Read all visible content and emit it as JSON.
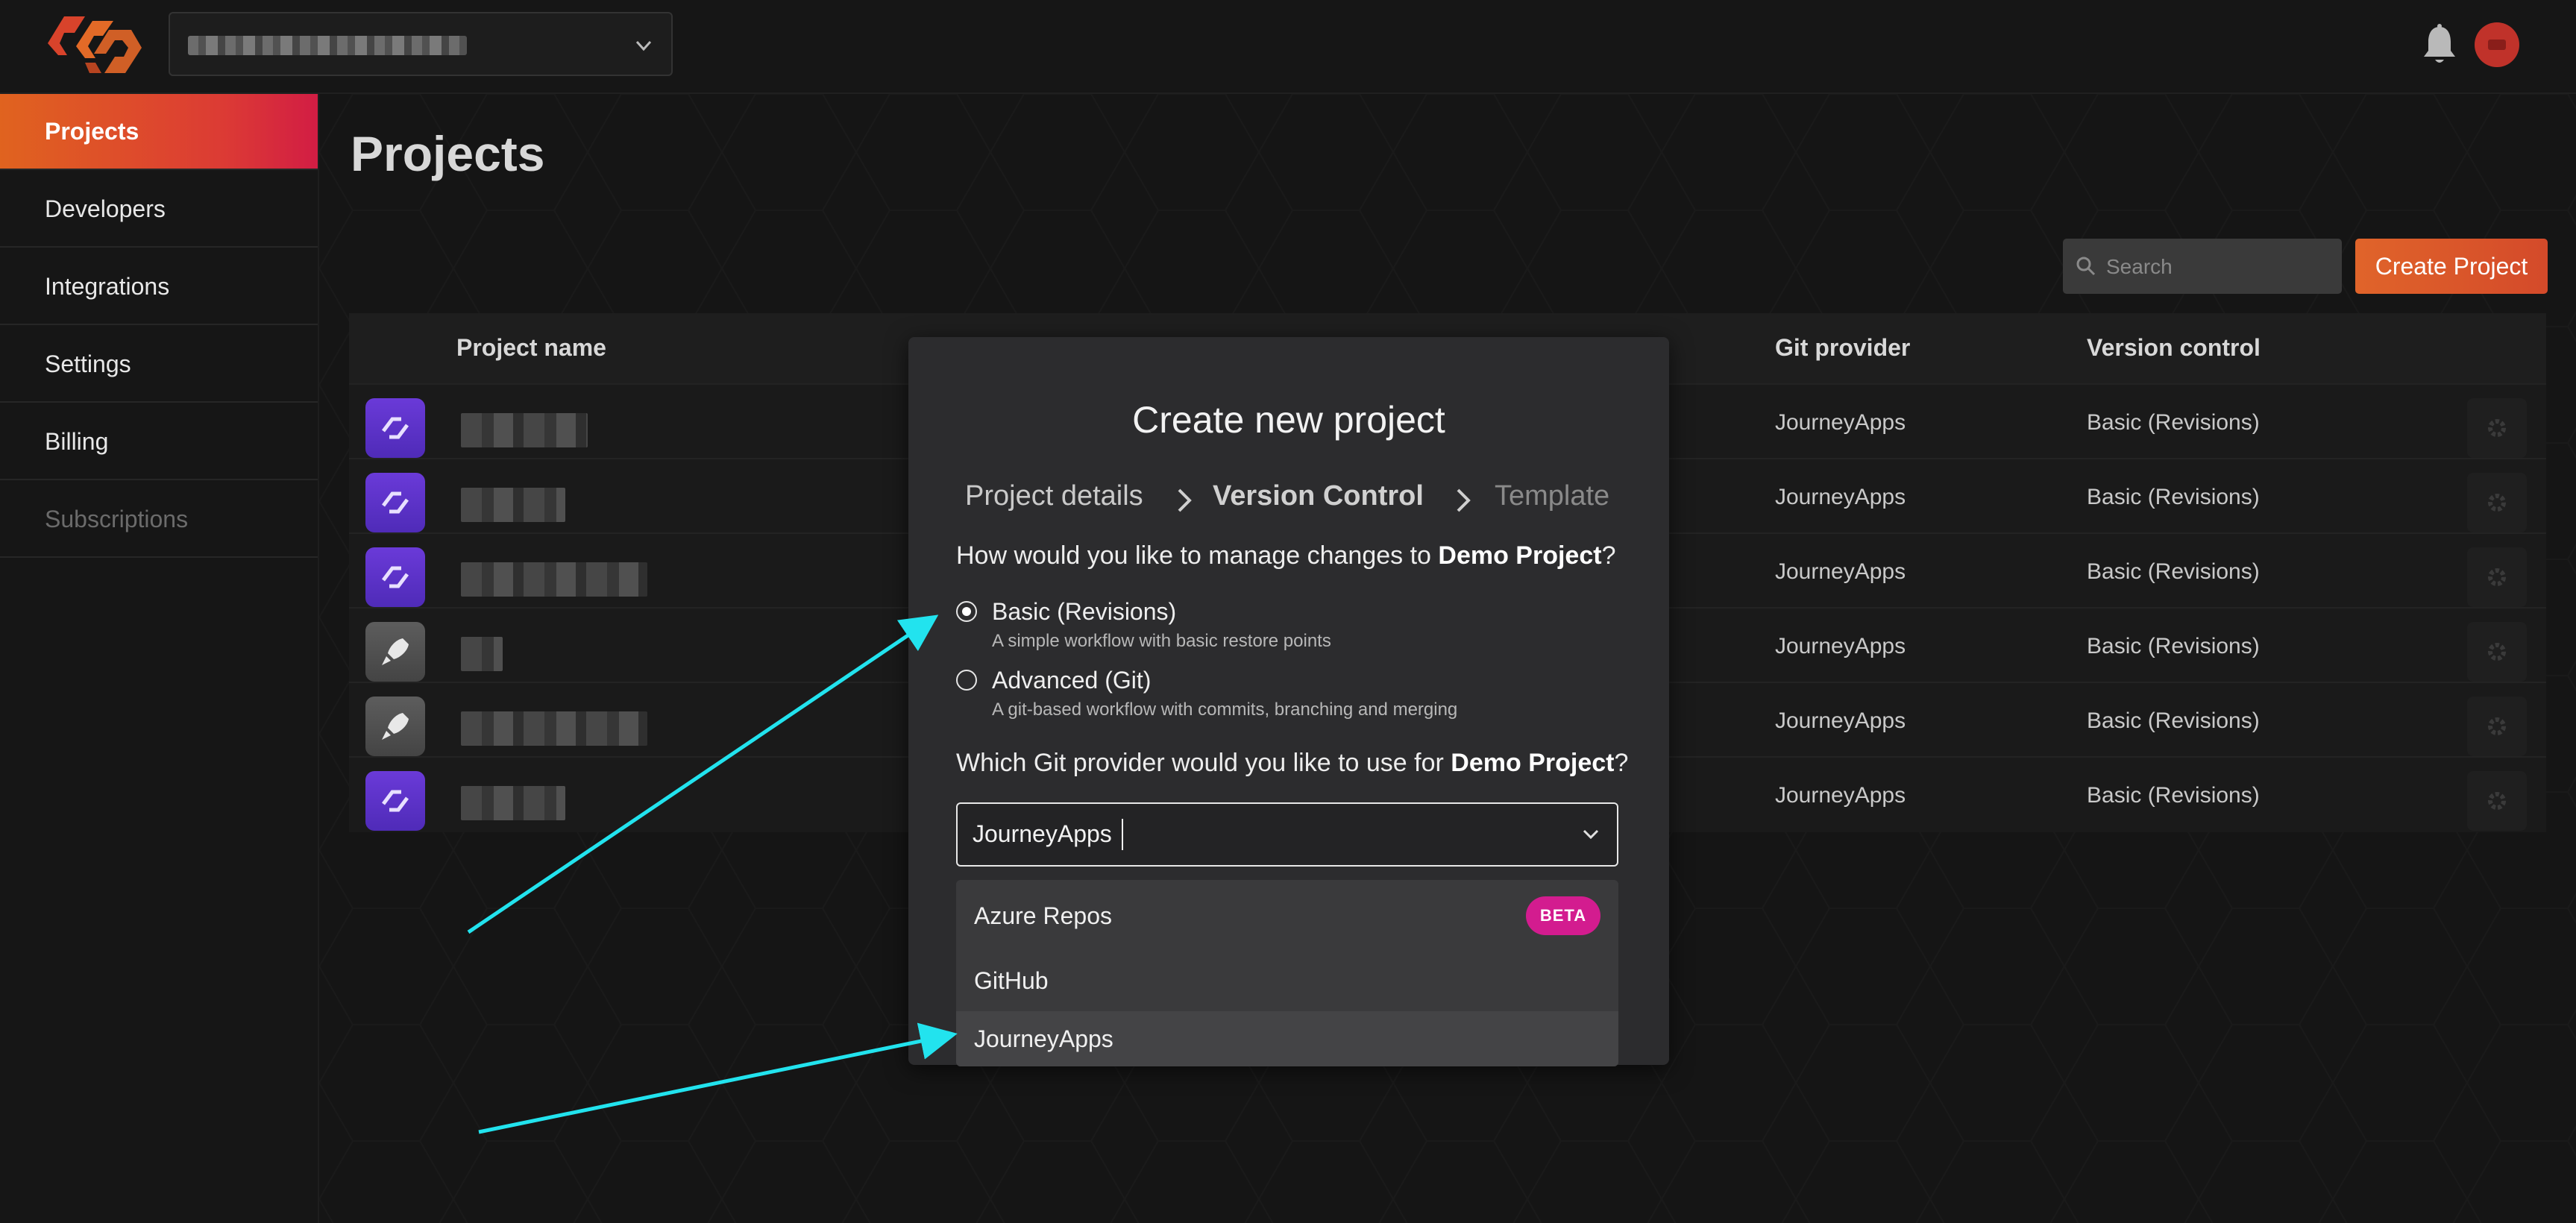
{
  "colors": {
    "accent_start": "#e0631f",
    "accent_end": "#d21d44",
    "beta_badge": "#d31c8f",
    "project_icon_purple": "#5b32c8",
    "project_icon_grey": "#555555",
    "annotation_arrow": "#22e3ee"
  },
  "header": {
    "logo_icon": "journeyapps-logo-icon",
    "notifications_icon": "bell-icon"
  },
  "sidebar": {
    "items": [
      {
        "label": "Projects",
        "state": "active"
      },
      {
        "label": "Developers",
        "state": "normal"
      },
      {
        "label": "Integrations",
        "state": "normal"
      },
      {
        "label": "Settings",
        "state": "normal"
      },
      {
        "label": "Billing",
        "state": "normal"
      },
      {
        "label": "Subscriptions",
        "state": "disabled"
      }
    ]
  },
  "main": {
    "title": "Projects",
    "search": {
      "placeholder": "Search"
    },
    "create_button": "Create Project",
    "table": {
      "headers": {
        "name": "Project name",
        "git_provider": "Git provider",
        "version_control": "Version control"
      },
      "rows": [
        {
          "icon": "purple",
          "c1": "S",
          "git_provider": "JourneyApps",
          "version_control": "Basic (Revisions)"
        },
        {
          "icon": "purple",
          "c1": "S",
          "git_provider": "JourneyApps",
          "version_control": "Basic (Revisions)"
        },
        {
          "icon": "purple",
          "c1": "S",
          "git_provider": "JourneyApps",
          "version_control": "Basic (Revisions)"
        },
        {
          "icon": "grey",
          "c1": "S",
          "git_provider": "JourneyApps",
          "version_control": "Basic (Revisions)"
        },
        {
          "icon": "grey",
          "c1": "T",
          "git_provider": "JourneyApps",
          "version_control": "Basic (Revisions)"
        },
        {
          "icon": "purple",
          "c1": "S",
          "git_provider": "JourneyApps",
          "version_control": "Basic (Revisions)"
        }
      ]
    }
  },
  "modal": {
    "title": "Create new project",
    "steps": [
      "Project details",
      "Version Control",
      "Template"
    ],
    "active_step": "Version Control",
    "question1_prefix": "How would you like to manage changes to ",
    "project_name": "Demo Project",
    "question_suffix": "?",
    "options": [
      {
        "label": "Basic (Revisions)",
        "description": "A simple workflow with basic restore points",
        "selected": true
      },
      {
        "label": "Advanced (Git)",
        "description": "A git-based workflow with commits, branching and merging",
        "selected": false
      }
    ],
    "question2_prefix": "Which Git provider would you like to use for ",
    "provider_value": "JourneyApps",
    "dropdown": [
      {
        "label": "Azure Repos",
        "badge": "BETA"
      },
      {
        "label": "GitHub",
        "badge": ""
      },
      {
        "label": "JourneyApps",
        "badge": ""
      }
    ]
  }
}
